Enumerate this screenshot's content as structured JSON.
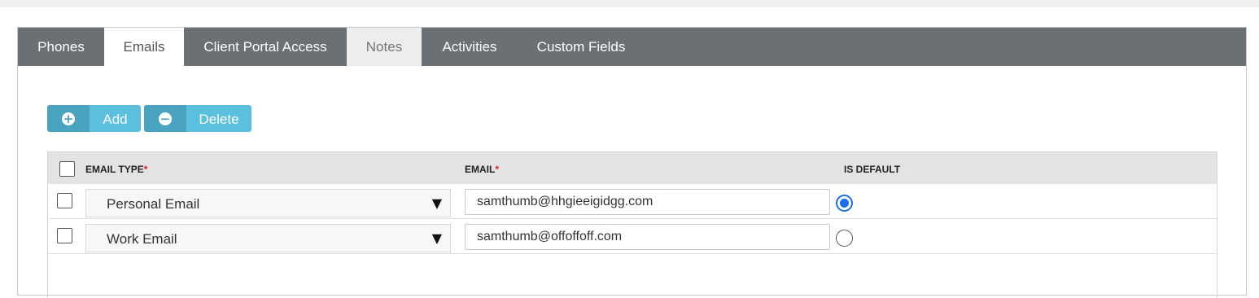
{
  "tabs": [
    {
      "label": "Phones"
    },
    {
      "label": "Emails"
    },
    {
      "label": "Client Portal Access"
    },
    {
      "label": "Notes"
    },
    {
      "label": "Activities"
    },
    {
      "label": "Custom Fields"
    }
  ],
  "toolbar": {
    "add_label": "Add",
    "delete_label": "Delete",
    "add_icon": "plus-circle-icon",
    "delete_icon": "minus-circle-icon"
  },
  "table": {
    "columns": {
      "email_type": "EMAIL TYPE",
      "email": "EMAIL",
      "is_default": "IS DEFAULT",
      "required_marker": "*"
    },
    "rows": [
      {
        "type": "Personal Email",
        "email": "samthumb@hhgieeigidgg.com",
        "default": true
      },
      {
        "type": "Work Email",
        "email": "samthumb@offoffoff.com",
        "default": false
      }
    ]
  },
  "colors": {
    "tabbar": "#6a7073",
    "button": "#5bc0de",
    "button_icon_bg": "#4aa3bf",
    "radio_selected": "#1a6fe8"
  }
}
